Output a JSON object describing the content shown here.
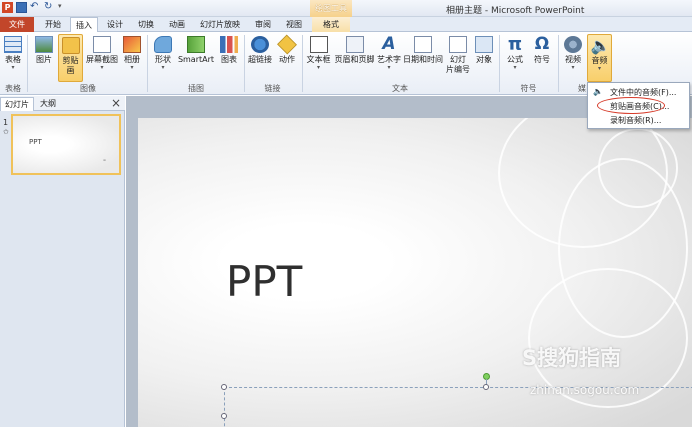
{
  "window": {
    "title": "相册主题 - Microsoft PowerPoint",
    "context_group": "绘图工具"
  },
  "quick_access": {
    "app_letter": "P"
  },
  "tabs": [
    {
      "label": "文件"
    },
    {
      "label": "开始"
    },
    {
      "label": "插入",
      "active": true
    },
    {
      "label": "设计"
    },
    {
      "label": "切换"
    },
    {
      "label": "动画"
    },
    {
      "label": "幻灯片放映"
    },
    {
      "label": "审阅"
    },
    {
      "label": "视图"
    },
    {
      "label": "格式"
    }
  ],
  "ribbon": {
    "buttons": {
      "table": "表格",
      "picture": "图片",
      "clipart": "剪贴画",
      "screenshot": "屏幕截图",
      "album": "相册",
      "shape": "形状",
      "smartart": "SmartArt",
      "chart": "图表",
      "hyperlink": "超链接",
      "action": "动作",
      "textbox": "文本框",
      "header_footer": "页眉和页脚",
      "wordart": "艺术字",
      "datetime": "日期和时间",
      "slide_number_1": "幻灯",
      "slide_number_2": "片编号",
      "object": "对象",
      "equation": "公式",
      "symbol": "符号",
      "video": "视频",
      "audio": "音频"
    },
    "groups": {
      "tables": "表格",
      "images": "图像",
      "illustrations": "插图",
      "links": "链接",
      "text": "文本",
      "symbols": "符号",
      "media": "媒"
    }
  },
  "audio_menu": {
    "items": [
      "文件中的音频(F)...",
      "剪贴画音频(C)...",
      "录制音频(R)..."
    ],
    "highlighted_index": 1
  },
  "left_panel": {
    "tabs": [
      "幻灯片",
      "大纲"
    ],
    "close_glyph": "×",
    "slide_number": "1",
    "thumb_title": "PPT"
  },
  "slide": {
    "title": "PPT"
  },
  "watermark": {
    "main": "S搜狗指南",
    "sub": "zhinan.sogou.com"
  }
}
